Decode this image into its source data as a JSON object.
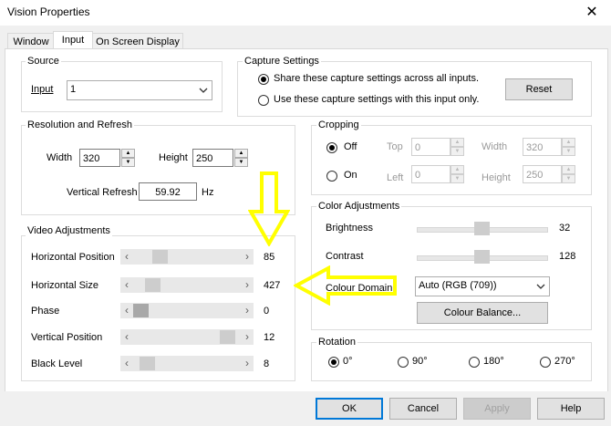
{
  "window": {
    "title": "Vision Properties",
    "close_glyph": "✕"
  },
  "tabs": [
    {
      "label": "Window",
      "active": false
    },
    {
      "label": "Input",
      "active": true
    },
    {
      "label": "On Screen Display",
      "active": false
    }
  ],
  "source": {
    "group_label": "Source",
    "input_label": "Input",
    "input_value": "1"
  },
  "capture": {
    "group_label": "Capture Settings",
    "option_all": "Share these capture settings across all inputs.",
    "option_this": "Use these capture settings with this input only.",
    "selected": "all",
    "reset_label": "Reset"
  },
  "resolution": {
    "group_label": "Resolution and Refresh",
    "width_label": "Width",
    "width_value": "320",
    "height_label": "Height",
    "height_value": "250",
    "refresh_label": "Vertical Refresh",
    "refresh_value": "59.92",
    "refresh_unit": "Hz"
  },
  "cropping": {
    "group_label": "Cropping",
    "off_label": "Off",
    "on_label": "On",
    "selected": "off",
    "top_label": "Top",
    "top_value": "0",
    "left_label": "Left",
    "left_value": "0",
    "width_label": "Width",
    "width_value": "320",
    "height_label": "Height",
    "height_value": "250"
  },
  "video": {
    "group_label": "Video Adjustments",
    "sliders": [
      {
        "label": "Horizontal Position",
        "value": "85",
        "position": 0.21
      },
      {
        "label": "Horizontal Size",
        "value": "427",
        "position": 0.13
      },
      {
        "label": "Phase",
        "value": "0",
        "position": 0.0
      },
      {
        "label": "Vertical Position",
        "value": "12",
        "position": 0.94
      },
      {
        "label": "Black Level",
        "value": "8",
        "position": 0.07
      }
    ]
  },
  "color": {
    "group_label": "Color Adjustments",
    "brightness_label": "Brightness",
    "brightness_value": "32",
    "brightness_position": 0.5,
    "contrast_label": "Contrast",
    "contrast_value": "128",
    "contrast_position": 0.5,
    "domain_label": "Colour Domain",
    "domain_value": "Auto (RGB (709))",
    "balance_label": "Colour Balance..."
  },
  "rotation": {
    "group_label": "Rotation",
    "options": [
      "0°",
      "90°",
      "180°",
      "270°"
    ],
    "selected": "0°"
  },
  "buttons": {
    "ok": "OK",
    "cancel": "Cancel",
    "apply": "Apply",
    "help": "Help"
  },
  "annotations": {
    "arrow_color": "#ffff00"
  }
}
